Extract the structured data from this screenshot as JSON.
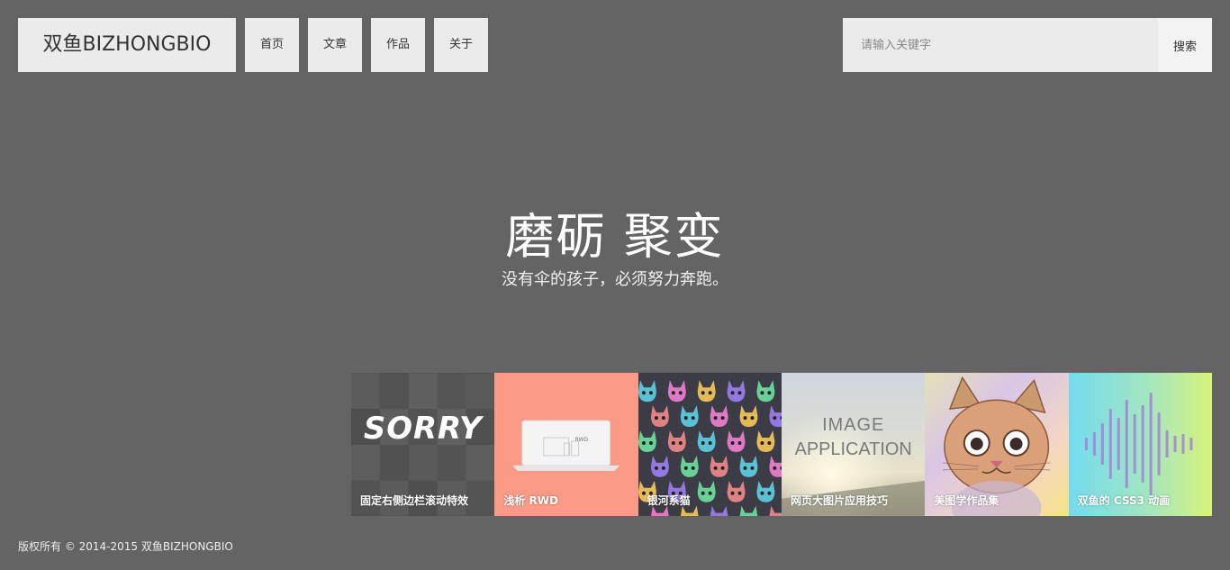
{
  "header": {
    "logo": "双鱼BIZHONGBIO",
    "nav": [
      {
        "label": "首页"
      },
      {
        "label": "文章"
      },
      {
        "label": "作品"
      },
      {
        "label": "关于"
      }
    ],
    "search": {
      "placeholder": "请输入关键字",
      "button_label": "搜索"
    }
  },
  "hero": {
    "title": "磨砺 聚变",
    "subtitle": "没有伞的孩子，必须努力奔跑。"
  },
  "gallery": {
    "items": [
      {
        "caption": "固定右侧边栏滚动特效",
        "art_text": "SORRY",
        "icon": "photo-collage-icon"
      },
      {
        "caption": "浅析 RWD",
        "art_text": "RWD",
        "icon": "laptop-icon"
      },
      {
        "caption": "银河系猫",
        "icon": "galaxy-cats-icon"
      },
      {
        "caption": "网页大图片应用技巧",
        "art_text": [
          "IMAGE",
          "APPLICATION"
        ],
        "icon": "image-application-icon"
      },
      {
        "caption": "美图学作品集",
        "icon": "cat-drawing-icon"
      },
      {
        "caption": "双鱼的 CSS3 动画",
        "icon": "sound-wave-icon"
      }
    ]
  },
  "footer": {
    "copyright": "版权所有 © 2014-2015 双鱼BIZHONGBIO"
  },
  "colors": {
    "background": "#646464",
    "panel": "#ebebeb",
    "rwd_tile": "#fa9a87"
  }
}
